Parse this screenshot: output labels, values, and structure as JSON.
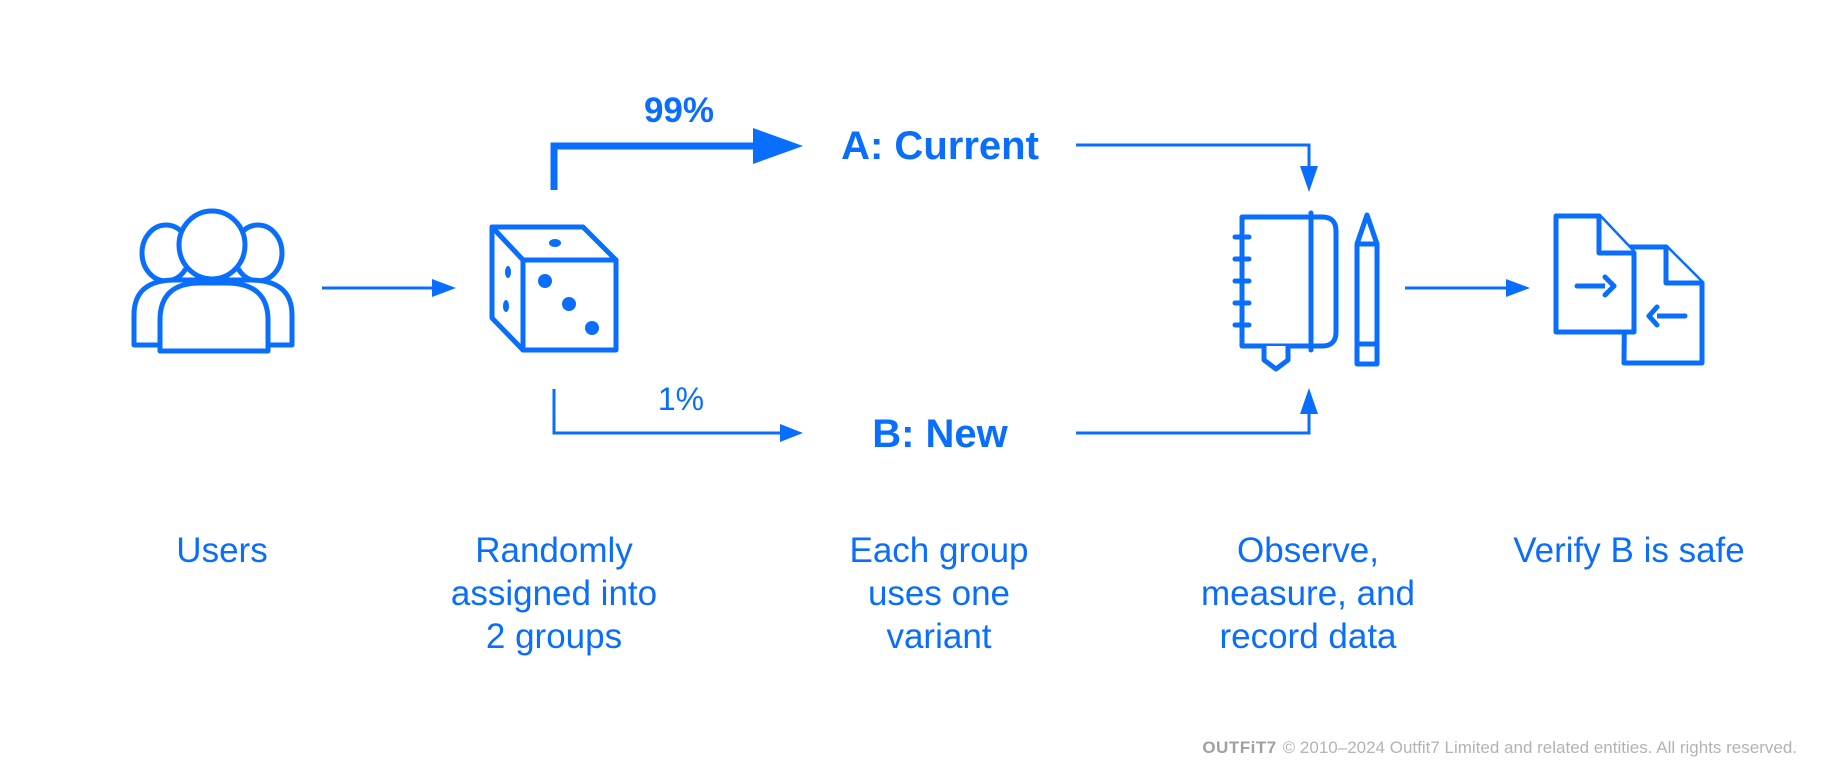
{
  "colors": {
    "accent": "#0a6efd",
    "footer": "#b3b3b3"
  },
  "branches": {
    "a": {
      "percent": "99%",
      "label": "A: Current"
    },
    "b": {
      "percent": "1%",
      "label": "B: New"
    }
  },
  "steps": [
    {
      "icon": "users-icon",
      "lines": [
        "Users"
      ]
    },
    {
      "icon": "dice-icon",
      "lines": [
        "Randomly",
        "assigned into",
        "2 groups"
      ]
    },
    {
      "icon": "",
      "lines": [
        "Each group",
        "uses one",
        "variant"
      ]
    },
    {
      "icon": "notebook-pencil-icon",
      "lines": [
        "Observe,",
        "measure, and",
        "record data"
      ]
    },
    {
      "icon": "documents-exchange-icon",
      "lines": [
        "Verify B is safe"
      ]
    }
  ],
  "footer": {
    "brand": "OUTFiT7",
    "text": "© 2010–2024 Outfit7 Limited and related entities. All rights reserved."
  }
}
